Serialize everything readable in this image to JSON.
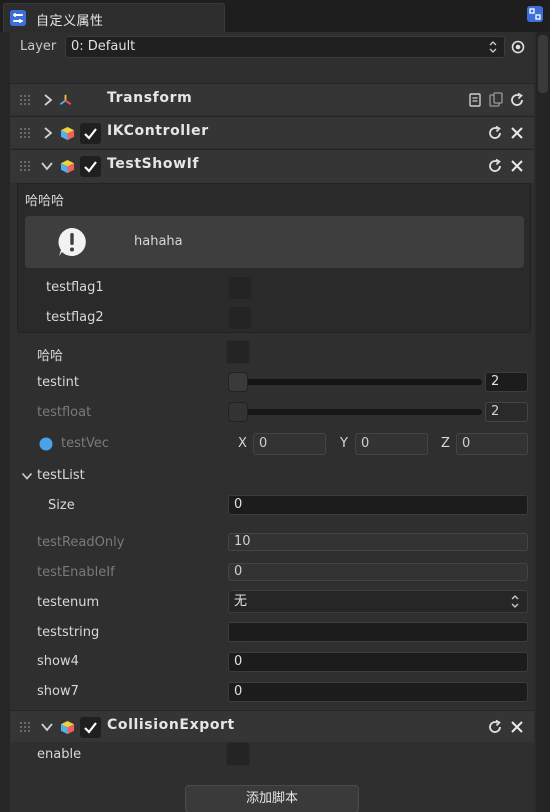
{
  "window": {
    "tab_title": "自定义属性"
  },
  "layer": {
    "label": "Layer",
    "value": "0: Default"
  },
  "components": [
    {
      "title": "Transform"
    },
    {
      "title": "IKController"
    },
    {
      "title": "TestShowIf"
    },
    {
      "title": "CollisionExport"
    }
  ],
  "testshowif": {
    "group_label": "哈哈哈",
    "info_text": "hahaha",
    "testflag1": "testflag1",
    "testflag2": "testflag2",
    "haha": "哈哈",
    "testint": {
      "label": "testint",
      "value": "2",
      "fraction": 0
    },
    "testfloat": {
      "label": "testfloat",
      "value": "2",
      "fraction": 0
    },
    "testvec": {
      "label": "testVec",
      "x_label": "X",
      "x": "0",
      "y_label": "Y",
      "y": "0",
      "z_label": "Z",
      "z": "0"
    },
    "testlist": {
      "label": "testList",
      "size_label": "Size",
      "size": "0"
    },
    "testreadonly": {
      "label": "testReadOnly",
      "value": "10"
    },
    "testenableif": {
      "label": "testEnableIf",
      "value": "0"
    },
    "testenum": {
      "label": "testenum",
      "value": "无"
    },
    "teststring": {
      "label": "teststring",
      "value": ""
    },
    "show4": {
      "label": "show4",
      "value": "0"
    },
    "show7": {
      "label": "show7",
      "value": "0"
    }
  },
  "collision": {
    "enable_label": "enable"
  },
  "add_script_button": "添加脚本",
  "colors": {
    "accent": "#3c6fd8",
    "vec_dot": "#4aa3e8"
  }
}
